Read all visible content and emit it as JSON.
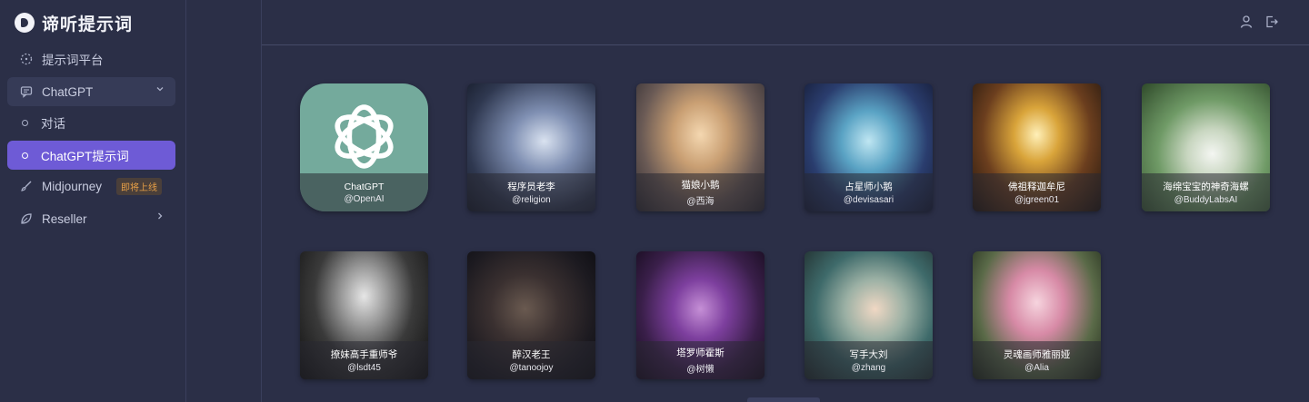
{
  "brand": {
    "title": "谛听提示词"
  },
  "nav": {
    "platform": "提示词平台",
    "chatgpt": "ChatGPT",
    "dialog": "对话",
    "chatgpt_prompts": "ChatGPT提示词",
    "midjourney": "Midjourney",
    "midjourney_badge": "即将上线",
    "reseller": "Reseller"
  },
  "cards": [
    {
      "name": "ChatGPT",
      "handle": "@OpenAI"
    },
    {
      "name": "程序员老李",
      "handle": "@religion"
    },
    {
      "name": "猫娘小鹅",
      "handle": "@西海"
    },
    {
      "name": "占星师小鹅",
      "handle": "@devisasari"
    },
    {
      "name": "佛祖释迦牟尼",
      "handle": "@jgreen01"
    },
    {
      "name": "海绵宝宝的神奇海螺",
      "handle": "@BuddyLabsAI"
    },
    {
      "name": "撩妹高手重师爷",
      "handle": "@lsdt45"
    },
    {
      "name": "醉汉老王",
      "handle": "@tanoojoy"
    },
    {
      "name": "塔罗师霍斯",
      "handle": "@树懒"
    },
    {
      "name": "写手大刘",
      "handle": "@zhang"
    },
    {
      "name": "灵魂画师雅丽娅",
      "handle": "@Alia"
    }
  ],
  "colors": {
    "background": "#2b2f47",
    "accent": "#6e5bd6",
    "badge": "#e8a047"
  }
}
